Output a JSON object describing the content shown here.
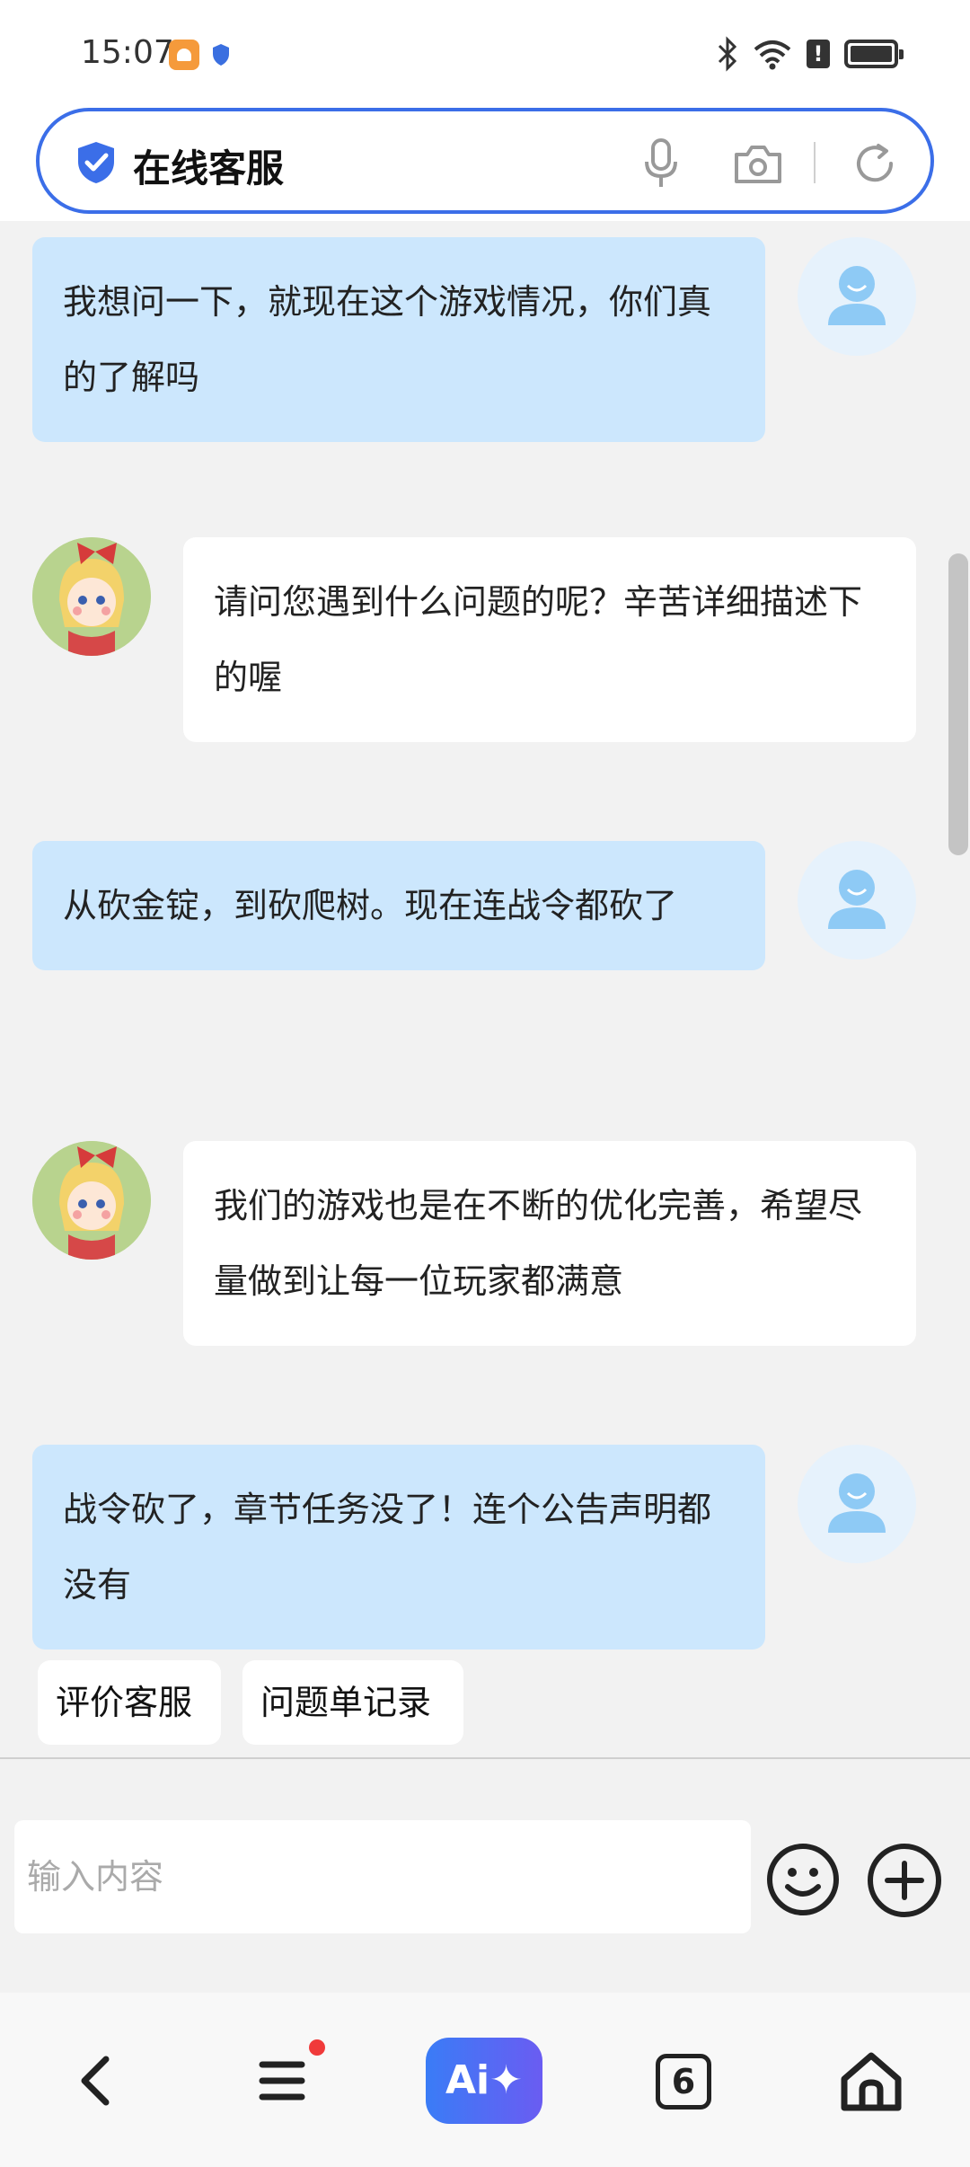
{
  "status_bar": {
    "time": "15:07"
  },
  "search_bar": {
    "title": "在线客服"
  },
  "messages": [
    {
      "role": "user",
      "text": "我想问一下，就现在这个游戏情况，你们真的了解吗"
    },
    {
      "role": "agent",
      "text": "请问您遇到什么问题的呢？辛苦详细描述下的喔"
    },
    {
      "role": "user",
      "text": "从砍金锭，到砍爬树。现在连战令都砍了"
    },
    {
      "role": "agent",
      "text": "我们的游戏也是在不断的优化完善，希望尽量做到让每一位玩家都满意"
    },
    {
      "role": "user",
      "text": "战令砍了，章节任务没了！连个公告声明都没有"
    }
  ],
  "quick_actions": [
    "评价客服",
    "问题单记录"
  ],
  "input": {
    "placeholder": "输入内容"
  },
  "nav": {
    "ai_label": "Ai✦",
    "tabs_count": "6"
  },
  "colors": {
    "accent": "#3b6ee8",
    "user_bubble": "#cce7fd",
    "agent_bubble": "#ffffff"
  }
}
